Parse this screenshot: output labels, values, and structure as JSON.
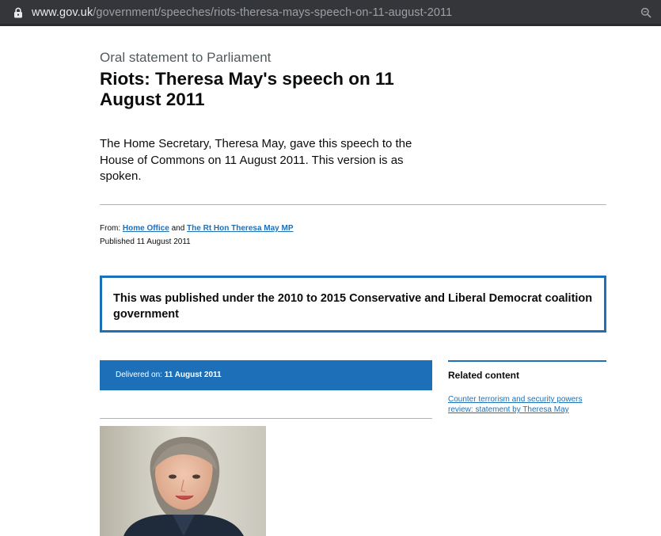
{
  "browser": {
    "url_domain": "www.gov.uk",
    "url_path": "/government/speeches/riots-theresa-mays-speech-on-11-august-2011"
  },
  "page": {
    "kicker": "Oral statement to Parliament",
    "title": "Riots: Theresa May's speech on 11 August 2011",
    "description": "The Home Secretary, Theresa May, gave this speech to the House of Commons on 11 August 2011. This version is as spoken."
  },
  "metadata": {
    "from_label": "From:",
    "org1": "Home Office",
    "and_label": "and",
    "org2": "The Rt Hon Theresa May MP",
    "published": "Published 11 August 2011"
  },
  "notice": {
    "text": "This was published under the 2010 to 2015 Conservative and Liberal Democrat coalition government"
  },
  "delivered": {
    "label": "Delivered on:",
    "date": "11 August 2011"
  },
  "related": {
    "heading": "Related content",
    "link": "Counter terrorism and security powers review: statement by Theresa May"
  },
  "colors": {
    "link_blue": "#1d70b8",
    "text": "#0b0c0c",
    "url_bar": "#35363a"
  }
}
